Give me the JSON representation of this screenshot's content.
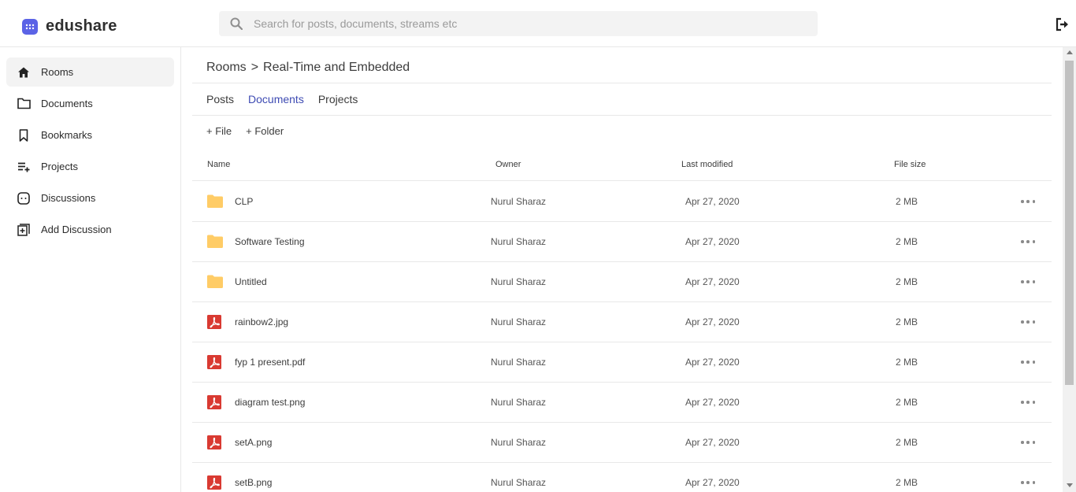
{
  "app": {
    "name": "edushare",
    "logo_icon": "grid-dots-icon",
    "accent_color": "#5b63e6"
  },
  "search": {
    "placeholder": "Search for posts, documents, streams etc",
    "value": ""
  },
  "header": {
    "logout_icon": "logout-icon"
  },
  "sidebar": {
    "items": [
      {
        "label": "Rooms",
        "icon": "home-icon",
        "active": true
      },
      {
        "label": "Documents",
        "icon": "folder-icon",
        "active": false
      },
      {
        "label": "Bookmarks",
        "icon": "bookmark-icon",
        "active": false
      },
      {
        "label": "Projects",
        "icon": "playlist-add-icon",
        "active": false
      },
      {
        "label": "Discussions",
        "icon": "chat-icon",
        "active": false
      },
      {
        "label": "Add Discussion",
        "icon": "add-box-icon",
        "active": false
      }
    ]
  },
  "breadcrumb": {
    "root": "Rooms",
    "separator": ">",
    "current": "Real-Time and Embedded"
  },
  "tabs": [
    {
      "label": "Posts",
      "active": false
    },
    {
      "label": "Documents",
      "active": true
    },
    {
      "label": "Projects",
      "active": false
    }
  ],
  "actions": {
    "add_file": "+ File",
    "add_folder": "+ Folder"
  },
  "table": {
    "headers": {
      "name": "Name",
      "owner": "Owner",
      "modified": "Last modified",
      "size": "File size"
    },
    "rows": [
      {
        "name": "CLP",
        "type": "folder",
        "owner": "Nurul Sharaz",
        "modified": "Apr 27, 2020",
        "size": "2 MB"
      },
      {
        "name": "Software Testing",
        "type": "folder",
        "owner": "Nurul Sharaz",
        "modified": "Apr 27, 2020",
        "size": "2 MB"
      },
      {
        "name": "Untitled",
        "type": "folder",
        "owner": "Nurul Sharaz",
        "modified": "Apr 27, 2020",
        "size": "2 MB"
      },
      {
        "name": "rainbow2.jpg",
        "type": "pdf",
        "owner": "Nurul Sharaz",
        "modified": "Apr 27, 2020",
        "size": "2 MB"
      },
      {
        "name": "fyp 1 present.pdf",
        "type": "pdf",
        "owner": "Nurul Sharaz",
        "modified": "Apr 27, 2020",
        "size": "2 MB"
      },
      {
        "name": "diagram test.png",
        "type": "pdf",
        "owner": "Nurul Sharaz",
        "modified": "Apr 27, 2020",
        "size": "2 MB"
      },
      {
        "name": "setA.png",
        "type": "pdf",
        "owner": "Nurul Sharaz",
        "modified": "Apr 27, 2020",
        "size": "2 MB"
      },
      {
        "name": "setB.png",
        "type": "pdf",
        "owner": "Nurul Sharaz",
        "modified": "Apr 27, 2020",
        "size": "2 MB"
      }
    ]
  },
  "colors": {
    "active_tab": "#3e4bb3",
    "folder": "#ffcc66",
    "pdf": "#d93a32"
  }
}
